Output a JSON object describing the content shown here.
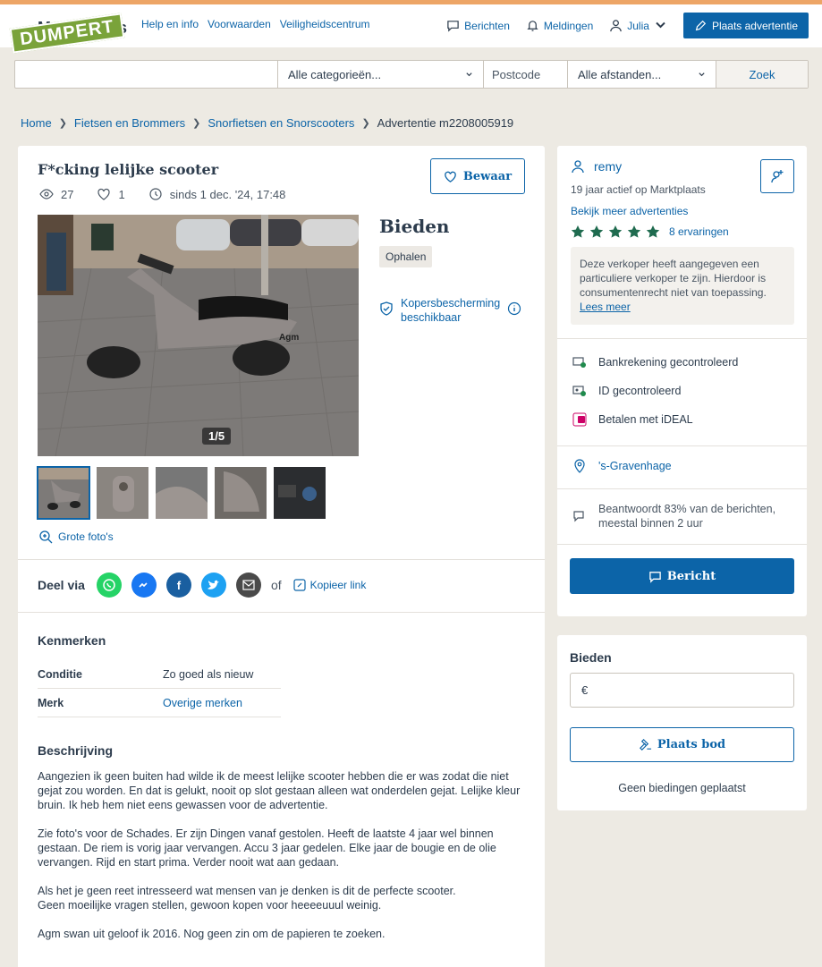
{
  "brand": {
    "name": "Marktplaats",
    "stamp": "DUMPERT",
    "accent": "#0c64a8",
    "stripe": "#eda566"
  },
  "nav": {
    "links": [
      "Help en info",
      "Voorwaarden",
      "Veiligheidscentrum"
    ]
  },
  "header": {
    "messages": "Berichten",
    "notifications": "Meldingen",
    "user": "Julia",
    "place_ad": "Plaats advertentie"
  },
  "search": {
    "query": "",
    "category": "Alle categorieën...",
    "postcode_placeholder": "Postcode",
    "distance": "Alle afstanden...",
    "submit": "Zoek"
  },
  "breadcrumb": [
    "Home",
    "Fietsen en Brommers",
    "Snorfietsen en Snorscooters",
    "Advertentie m2208005919"
  ],
  "listing": {
    "title": "F*cking lelijke scooter",
    "views": "27",
    "favorites": "1",
    "since": "sinds 1 dec. '24, 17:48",
    "save": "Bewaar",
    "photo_counter": "1/5",
    "big_photos": "Grote foto's",
    "price": "Bieden",
    "delivery": "Ophalen",
    "buyer_protection": "Kopersbescherming beschikbaar"
  },
  "share": {
    "label": "Deel via",
    "or": "of",
    "copy_link": "Kopieer link"
  },
  "specs": {
    "heading": "Kenmerken",
    "rows": [
      {
        "key": "Conditie",
        "value": "Zo goed als nieuw"
      },
      {
        "key": "Merk",
        "value": "Overige merken"
      }
    ]
  },
  "description": {
    "heading": "Beschrijving",
    "paragraphs": [
      "Aangezien ik geen buiten had wilde ik de meest lelijke scooter hebben die er was zodat die niet gejat zou worden. En dat is gelukt, nooit op slot gestaan alleen wat onderdelen gejat. Lelijke kleur bruin. Ik heb hem niet eens gewassen voor de advertentie.",
      "Zie foto's voor de Schades. Er zijn Dingen vanaf gestolen. Heeft de laatste 4 jaar wel binnen gestaan. De riem is vorig jaar vervangen. Accu 3 jaar gedelen. Elke jaar de bougie en de olie vervangen. Rijd en start prima. Verder nooit wat aan gedaan.",
      "Als het je geen reet intresseerd wat mensen van je denken is dit de perfecte scooter.\nGeen moeilijke vragen stellen, gewoon kopen voor heeeeuuul weinig.",
      "Agm swan uit geloof ik 2016. Nog geen zin om de papieren te zoeken."
    ]
  },
  "seller": {
    "name": "remy",
    "active": "19 jaar actief op Marktplaats",
    "more_ads": "Bekijk meer advertenties",
    "rating": 5,
    "experiences": "8 ervaringen",
    "notice": "Deze verkoper heeft aangegeven een particuliere verkoper te zijn. Hierdoor is consumentenrecht niet van toepassing.",
    "notice_link": "Lees meer",
    "verifications": [
      "Bankrekening gecontroleerd",
      "ID gecontroleerd",
      "Betalen met iDEAL"
    ],
    "location": "'s-Gravenhage",
    "response": "Beantwoordt 83% van de berichten, meestal binnen 2 uur",
    "message_button": "Bericht",
    "star_color": "#1f6b4f"
  },
  "bidding": {
    "heading": "Bieden",
    "currency": "€",
    "place_bid": "Plaats bod",
    "no_bids": "Geen biedingen geplaatst"
  }
}
